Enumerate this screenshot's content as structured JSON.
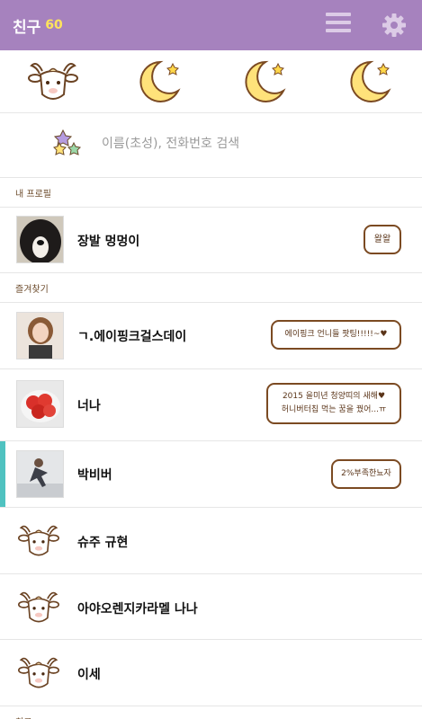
{
  "header": {
    "title": "친구",
    "friend_count": "60"
  },
  "search": {
    "placeholder": "이름(초성), 전화번호 검색"
  },
  "sections": {
    "my_profile": "내 프로필",
    "favorites": "즐겨찾기",
    "friends": "친구"
  },
  "my_profile": {
    "name": "장발 멍멍이",
    "status": "왈왈"
  },
  "favorites": [
    {
      "name": "ㄱ.에이핑크걸스데이",
      "status": "에이핑크 언니들 팟팅!!!!!~♥"
    },
    {
      "name": "너나",
      "status": "2015 을미년 청양띠의 새해♥\n허니버터칩 먹는 꿈을 꿨어...ㅠ"
    },
    {
      "name": "박비버",
      "status": "2%부족한뇨자"
    }
  ],
  "friends": [
    {
      "name": "슈주 규현"
    },
    {
      "name": "아야오렌지카라멜 나나"
    },
    {
      "name": "이세"
    }
  ],
  "colors": {
    "header": "#a682be",
    "accent": "#4fc2c0",
    "bubble_border": "#7b4a22",
    "count": "#ffe45c"
  },
  "icons": [
    "menu-icon",
    "gear-icon",
    "goat-icon",
    "moon-icon",
    "stars-icon"
  ]
}
